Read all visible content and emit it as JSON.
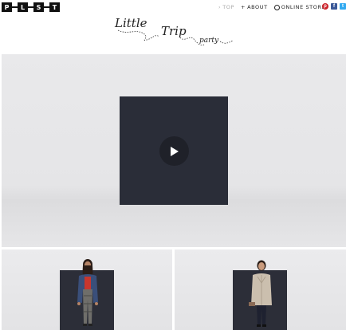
{
  "logo": {
    "letters": [
      "P",
      "L",
      "S",
      "T"
    ]
  },
  "title": {
    "word1": "Little",
    "word2": "Trip",
    "word3": "party"
  },
  "nav": {
    "top": "TOP",
    "about": "ABOUT",
    "store": "ONLINE STORE",
    "top_marker": "›",
    "about_marker": "+"
  },
  "social": {
    "icons": [
      "pinterest-icon",
      "facebook-icon",
      "twitter-icon"
    ],
    "pinterest_glyph": "p",
    "facebook_glyph": "f",
    "twitter_glyph": "t",
    "colors": {
      "pinterest": "#cb2027",
      "facebook": "#3b5998",
      "twitter": "#33aaf0"
    }
  },
  "colors": {
    "panel": "#2a2d38",
    "background": "#e7e7e9"
  }
}
